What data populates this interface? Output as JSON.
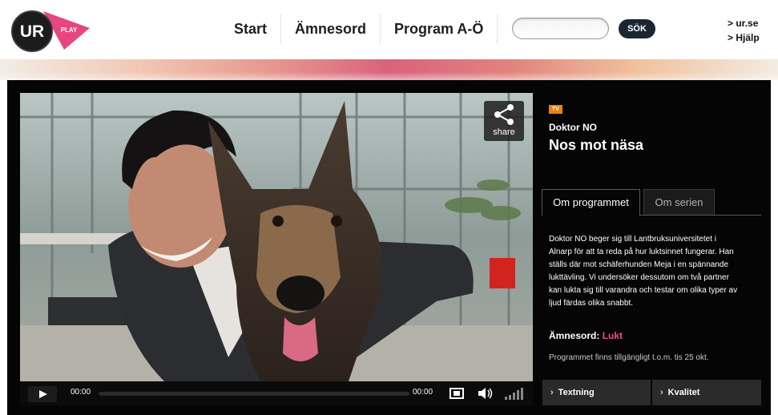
{
  "brand": {
    "logo_text_main": "UR",
    "logo_text_sub": "PLAY"
  },
  "nav": {
    "items": [
      {
        "label": "Start"
      },
      {
        "label": "Ämnesord"
      },
      {
        "label": "Program A-Ö"
      }
    ]
  },
  "search": {
    "value": "",
    "placeholder": "",
    "button_label": "SÖK"
  },
  "toplinks": {
    "items": [
      {
        "label": "> ur.se"
      },
      {
        "label": "> Hjälp"
      }
    ]
  },
  "player": {
    "share_label": "share",
    "time_current": "00:00",
    "time_total": "00:00",
    "progress": 0,
    "icons": [
      "play-icon",
      "fullscreen-icon",
      "volume-icon",
      "quality-bars-icon",
      "share-icon"
    ]
  },
  "program": {
    "badge": "TV",
    "series": "Doktor NO",
    "title": "Nos mot näsa",
    "tabs": [
      {
        "label": "Om programmet",
        "active": true
      },
      {
        "label": "Om serien",
        "active": false
      }
    ],
    "description_lines": [
      "Doktor NO beger sig till Lantbruksuniversitetet i",
      "Alnarp för att ta reda på hur luktsinnet fungerar. Han",
      "ställs där mot schäferhunden Meja i en spännande",
      "lukttävling. Vi undersöker dessutom om två partner",
      "kan lukta sig till varandra och testar om olika typer av",
      "ljud färdas olika snabbt."
    ],
    "subject_label": "Ämnesord: ",
    "subject_value": "Lukt",
    "availability": "Programmet finns tillgängligt t.o.m. tis 25 okt.",
    "options": [
      {
        "label": "Textning"
      },
      {
        "label": "Kvalitet"
      }
    ]
  },
  "colors": {
    "accent_pink": "#e84d8a",
    "badge_orange": "#e8840f",
    "dark_bg": "#050505",
    "search_button": "#1b2630"
  }
}
